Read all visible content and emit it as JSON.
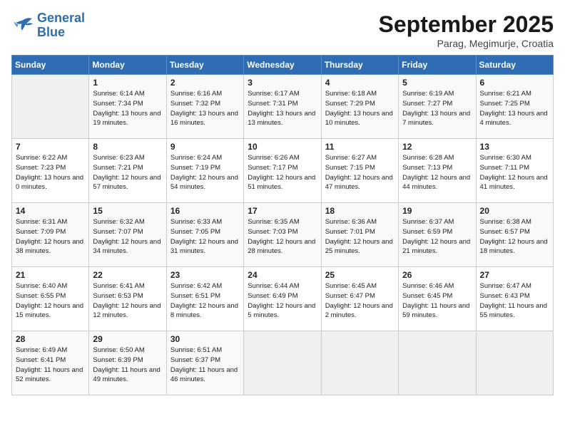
{
  "header": {
    "logo_line1": "General",
    "logo_line2": "Blue",
    "month": "September 2025",
    "location": "Parag, Megimurje, Croatia"
  },
  "days_of_week": [
    "Sunday",
    "Monday",
    "Tuesday",
    "Wednesday",
    "Thursday",
    "Friday",
    "Saturday"
  ],
  "weeks": [
    [
      {
        "day": "",
        "empty": true
      },
      {
        "day": "1",
        "sunrise": "6:14 AM",
        "sunset": "7:34 PM",
        "daylight": "13 hours and 19 minutes."
      },
      {
        "day": "2",
        "sunrise": "6:16 AM",
        "sunset": "7:32 PM",
        "daylight": "13 hours and 16 minutes."
      },
      {
        "day": "3",
        "sunrise": "6:17 AM",
        "sunset": "7:31 PM",
        "daylight": "13 hours and 13 minutes."
      },
      {
        "day": "4",
        "sunrise": "6:18 AM",
        "sunset": "7:29 PM",
        "daylight": "13 hours and 10 minutes."
      },
      {
        "day": "5",
        "sunrise": "6:19 AM",
        "sunset": "7:27 PM",
        "daylight": "13 hours and 7 minutes."
      },
      {
        "day": "6",
        "sunrise": "6:21 AM",
        "sunset": "7:25 PM",
        "daylight": "13 hours and 4 minutes."
      }
    ],
    [
      {
        "day": "7",
        "sunrise": "6:22 AM",
        "sunset": "7:23 PM",
        "daylight": "13 hours and 0 minutes."
      },
      {
        "day": "8",
        "sunrise": "6:23 AM",
        "sunset": "7:21 PM",
        "daylight": "12 hours and 57 minutes."
      },
      {
        "day": "9",
        "sunrise": "6:24 AM",
        "sunset": "7:19 PM",
        "daylight": "12 hours and 54 minutes."
      },
      {
        "day": "10",
        "sunrise": "6:26 AM",
        "sunset": "7:17 PM",
        "daylight": "12 hours and 51 minutes."
      },
      {
        "day": "11",
        "sunrise": "6:27 AM",
        "sunset": "7:15 PM",
        "daylight": "12 hours and 47 minutes."
      },
      {
        "day": "12",
        "sunrise": "6:28 AM",
        "sunset": "7:13 PM",
        "daylight": "12 hours and 44 minutes."
      },
      {
        "day": "13",
        "sunrise": "6:30 AM",
        "sunset": "7:11 PM",
        "daylight": "12 hours and 41 minutes."
      }
    ],
    [
      {
        "day": "14",
        "sunrise": "6:31 AM",
        "sunset": "7:09 PM",
        "daylight": "12 hours and 38 minutes."
      },
      {
        "day": "15",
        "sunrise": "6:32 AM",
        "sunset": "7:07 PM",
        "daylight": "12 hours and 34 minutes."
      },
      {
        "day": "16",
        "sunrise": "6:33 AM",
        "sunset": "7:05 PM",
        "daylight": "12 hours and 31 minutes."
      },
      {
        "day": "17",
        "sunrise": "6:35 AM",
        "sunset": "7:03 PM",
        "daylight": "12 hours and 28 minutes."
      },
      {
        "day": "18",
        "sunrise": "6:36 AM",
        "sunset": "7:01 PM",
        "daylight": "12 hours and 25 minutes."
      },
      {
        "day": "19",
        "sunrise": "6:37 AM",
        "sunset": "6:59 PM",
        "daylight": "12 hours and 21 minutes."
      },
      {
        "day": "20",
        "sunrise": "6:38 AM",
        "sunset": "6:57 PM",
        "daylight": "12 hours and 18 minutes."
      }
    ],
    [
      {
        "day": "21",
        "sunrise": "6:40 AM",
        "sunset": "6:55 PM",
        "daylight": "12 hours and 15 minutes."
      },
      {
        "day": "22",
        "sunrise": "6:41 AM",
        "sunset": "6:53 PM",
        "daylight": "12 hours and 12 minutes."
      },
      {
        "day": "23",
        "sunrise": "6:42 AM",
        "sunset": "6:51 PM",
        "daylight": "12 hours and 8 minutes."
      },
      {
        "day": "24",
        "sunrise": "6:44 AM",
        "sunset": "6:49 PM",
        "daylight": "12 hours and 5 minutes."
      },
      {
        "day": "25",
        "sunrise": "6:45 AM",
        "sunset": "6:47 PM",
        "daylight": "12 hours and 2 minutes."
      },
      {
        "day": "26",
        "sunrise": "6:46 AM",
        "sunset": "6:45 PM",
        "daylight": "11 hours and 59 minutes."
      },
      {
        "day": "27",
        "sunrise": "6:47 AM",
        "sunset": "6:43 PM",
        "daylight": "11 hours and 55 minutes."
      }
    ],
    [
      {
        "day": "28",
        "sunrise": "6:49 AM",
        "sunset": "6:41 PM",
        "daylight": "11 hours and 52 minutes."
      },
      {
        "day": "29",
        "sunrise": "6:50 AM",
        "sunset": "6:39 PM",
        "daylight": "11 hours and 49 minutes."
      },
      {
        "day": "30",
        "sunrise": "6:51 AM",
        "sunset": "6:37 PM",
        "daylight": "11 hours and 46 minutes."
      },
      {
        "day": "",
        "empty": true
      },
      {
        "day": "",
        "empty": true
      },
      {
        "day": "",
        "empty": true
      },
      {
        "day": "",
        "empty": true
      }
    ]
  ]
}
